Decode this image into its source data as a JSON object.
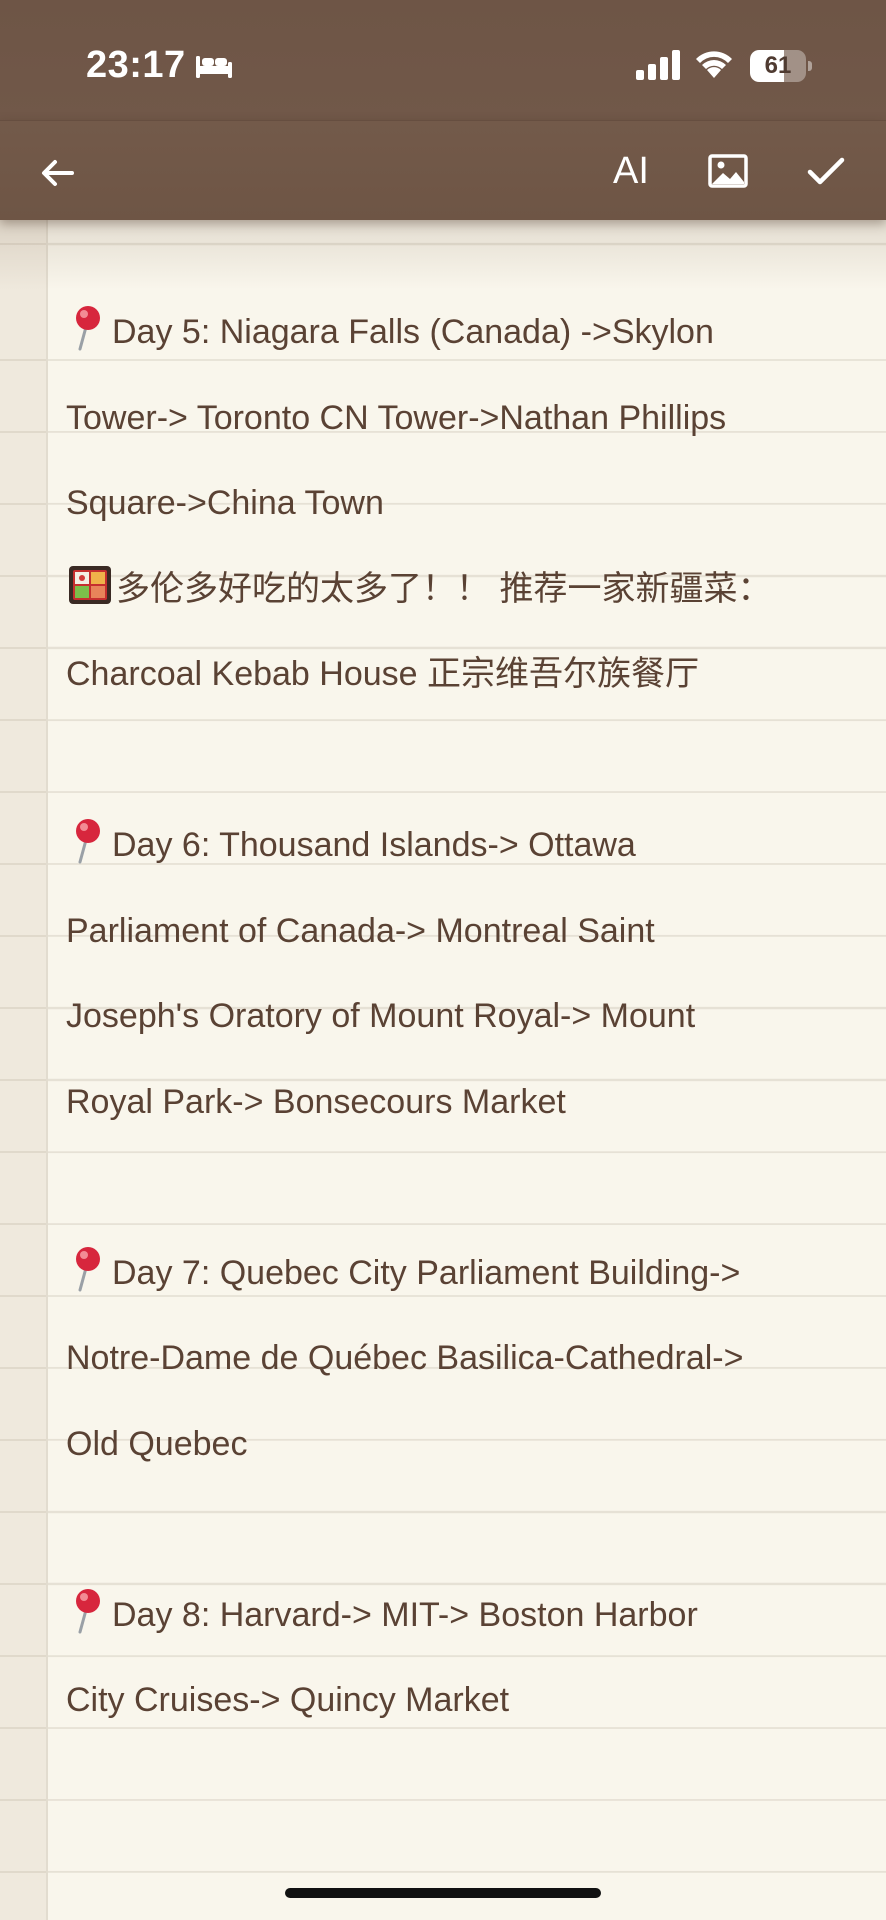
{
  "status_bar": {
    "time": "23:17",
    "battery_level": "61",
    "battery_fraction": 0.61
  },
  "toolbar": {
    "ai_label": "AI"
  },
  "note": {
    "lines": [
      "Day 5: Niagara Falls (Canada) ->Skylon",
      "Tower-> Toronto CN Tower->Nathan Phillips",
      "Square->China Town",
      "多伦多好吃的太多了！！ 推荐一家新疆菜：",
      "Charcoal Kebab House 正宗维吾尔族餐厅",
      "",
      "Day 6: Thousand Islands-> Ottawa",
      "Parliament of Canada-> Montreal Saint",
      "Joseph's Oratory of Mount Royal-> Mount",
      "Royal Park-> Bonsecours Market",
      "",
      "Day 7: Quebec City Parliament Building->",
      "Notre-Dame de Québec Basilica-Cathedral->",
      "Old Quebec",
      "",
      "Day 8: Harvard-> MIT-> Boston Harbor",
      "City Cruises-> Quincy Market"
    ]
  },
  "colors": {
    "toolbar_brown": "#6e5546",
    "paper": "#f9f6ec",
    "text": "#5a4234",
    "rule_line": "#e6e1d5"
  },
  "icons": [
    "bed-icon",
    "signal-icon",
    "wifi-icon",
    "battery-icon",
    "back-arrow-icon",
    "image-icon",
    "checkmark-icon",
    "pin-icon",
    "bento-box-icon"
  ]
}
